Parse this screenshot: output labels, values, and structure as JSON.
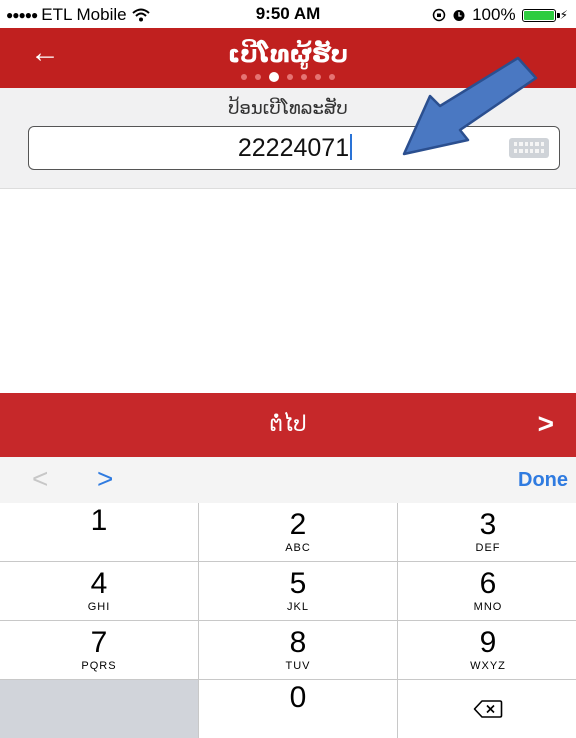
{
  "status_bar": {
    "carrier": "ETL Mobile",
    "time": "9:50 AM",
    "battery": "100%",
    "battery_color": "#2ecc40"
  },
  "header": {
    "title": "ເບີໂທຜູ້ຮັບ",
    "back_icon": "arrow-left-icon",
    "color": "#c0201f",
    "page_count": 7,
    "active_page": 2
  },
  "form": {
    "label": "ປ້ອນເບີໂທລະສັບ",
    "phone_value": "22224071",
    "keyboard_icon": "keyboard-icon"
  },
  "next_bar": {
    "label": "ຕໍ່ໄປ",
    "chevron": ">"
  },
  "accessory": {
    "prev": "<",
    "next": ">",
    "done": "Done"
  },
  "keypad": {
    "keys": [
      {
        "num": "1",
        "letters": ""
      },
      {
        "num": "2",
        "letters": "ABC"
      },
      {
        "num": "3",
        "letters": "DEF"
      },
      {
        "num": "4",
        "letters": "GHI"
      },
      {
        "num": "5",
        "letters": "JKL"
      },
      {
        "num": "6",
        "letters": "MNO"
      },
      {
        "num": "7",
        "letters": "PQRS"
      },
      {
        "num": "8",
        "letters": "TUV"
      },
      {
        "num": "9",
        "letters": "WXYZ"
      },
      {
        "num": "0",
        "letters": ""
      }
    ]
  }
}
